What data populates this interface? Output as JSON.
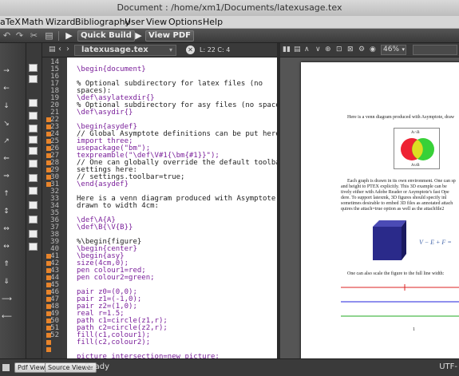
{
  "window": {
    "title": "Document : /home/xm1/Documents/latexusage.tex"
  },
  "menu": [
    "aTeX",
    "Math",
    "Wizard",
    "Bibliography",
    "User",
    "View",
    "Options",
    "Help"
  ],
  "toolbar": {
    "quick_build": "Quick Build",
    "view_pdf": "View PDF"
  },
  "editor": {
    "tab": "latexusage.tex",
    "position": "L: 22 C: 4",
    "line_numbers": [
      "14",
      "15",
      "16",
      "17",
      "18",
      "19",
      "20",
      "21",
      "22",
      "23",
      "24",
      "25",
      "26",
      "27",
      "28",
      "29",
      "30",
      "31",
      "32",
      "33",
      "34",
      "35",
      "36",
      "37",
      "38",
      "39",
      "40",
      "41",
      "42",
      "43",
      "44",
      "45",
      "46",
      "47",
      "48",
      "49",
      "50",
      "51",
      "52"
    ],
    "lines": [
      "",
      "\\begin{document}",
      "",
      "% Optional subdirectory for latex files (no",
      "spaces):",
      "\\def\\asylatexdir{}",
      "% Optional subdirectory for asy files (no spaces):",
      "\\def\\asydir{}",
      "",
      "\\begin{asydef}",
      "// Global Asymptote definitions can be put here.",
      "import three;",
      "usepackage(\"bm\");",
      "texpreamble(\"\\def\\V#1{\\bm{#1}}\");",
      "// One can globally override the default toolbar",
      "settings here:",
      "// settings.toolbar=true;",
      "\\end{asydef}",
      "",
      "Here is a venn diagram produced with Asymptote,",
      "drawn to width 4cm:",
      "",
      "\\def\\A{A}",
      "\\def\\B{\\V{B}}",
      "",
      "%\\begin{figure}",
      "\\begin{center}",
      "\\begin{asy}",
      "size(4cm,0);",
      "pen colour1=red;",
      "pen colour2=green;",
      "",
      "pair z0=(0,0);",
      "pair z1=(-1,0);",
      "pair z2=(1,0);",
      "real r=1.5;",
      "path c1=circle(z1,r);",
      "path c2=circle(z2,r);",
      "fill(c1,colour1);",
      "fill(c2,colour2);",
      "",
      "picture intersection=new picture;"
    ]
  },
  "pdf": {
    "zoom": "46%",
    "text1": "Here is a venn diagram produced with Asymptote, draw",
    "venn_top": "A∩B",
    "venn_bottom": "A∪B",
    "para": [
      "Each graph is drawn in its own environment. One can sp",
      "and height to PTEX explicitly. This 3D example can be",
      "tively either with Adobe Reader or Asymptote's fast Ope",
      "dere. To support latexmk, 3D figures should specify inl",
      "sometimes desirable to embed 3D files as annotated attach",
      "quires the attach=true option as well as the attachfile2"
    ],
    "euler": "V − E + F =",
    "text2": "One can also scale the figure to the full line width:",
    "page_num": "1"
  },
  "status": {
    "structure_btn": "Pdf Viewer",
    "source_btn": "Source Viewer",
    "ready": "Ready",
    "encoding": "UTF-"
  }
}
